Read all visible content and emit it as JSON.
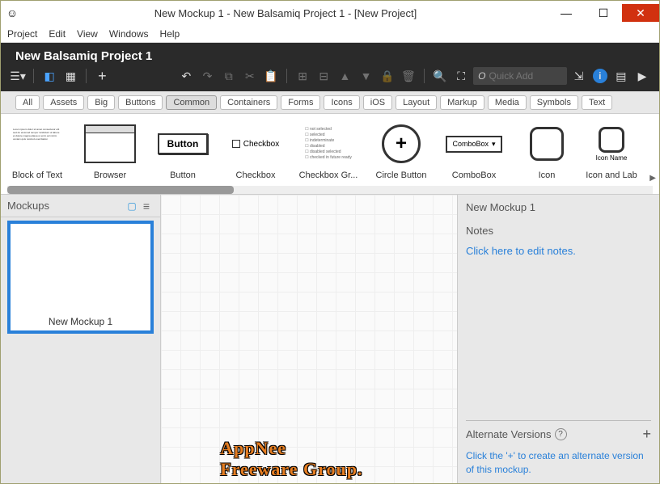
{
  "window": {
    "title": "New Mockup 1 - New Balsamiq Project 1 - [New Project]",
    "icon": "☺"
  },
  "menubar": [
    "Project",
    "Edit",
    "View",
    "Windows",
    "Help"
  ],
  "project_title": "New Balsamiq Project 1",
  "quick_add": {
    "prefix": "O",
    "placeholder": "Quick Add"
  },
  "categories": [
    "All",
    "Assets",
    "Big",
    "Buttons",
    "Common",
    "Containers",
    "Forms",
    "Icons",
    "iOS",
    "Layout",
    "Markup",
    "Media",
    "Symbols",
    "Text"
  ],
  "active_category": "Common",
  "shelf": [
    {
      "label": "Block of Text"
    },
    {
      "label": "Browser"
    },
    {
      "label": "Button",
      "preview_text": "Button"
    },
    {
      "label": "Checkbox",
      "preview_text": "Checkbox"
    },
    {
      "label": "Checkbox Gr...",
      "options": [
        "not selected",
        "selected",
        "indeterminate",
        "disabled",
        "disabled selected",
        "checked in future ready"
      ]
    },
    {
      "label": "Circle Button"
    },
    {
      "label": "ComboBox",
      "preview_text": "ComboBox"
    },
    {
      "label": "Icon"
    },
    {
      "label": "Icon and Lab",
      "preview_text": "Icon Name"
    }
  ],
  "sidebar": {
    "title": "Mockups",
    "items": [
      {
        "label": "New Mockup 1"
      }
    ]
  },
  "inspector": {
    "title": "New Mockup 1",
    "notes_label": "Notes",
    "notes_placeholder": "Click here to edit notes.",
    "alt_label": "Alternate Versions",
    "alt_placeholder": "Click the '+' to create an alternate version of this mockup."
  },
  "watermark": "AppNee Freeware Group."
}
